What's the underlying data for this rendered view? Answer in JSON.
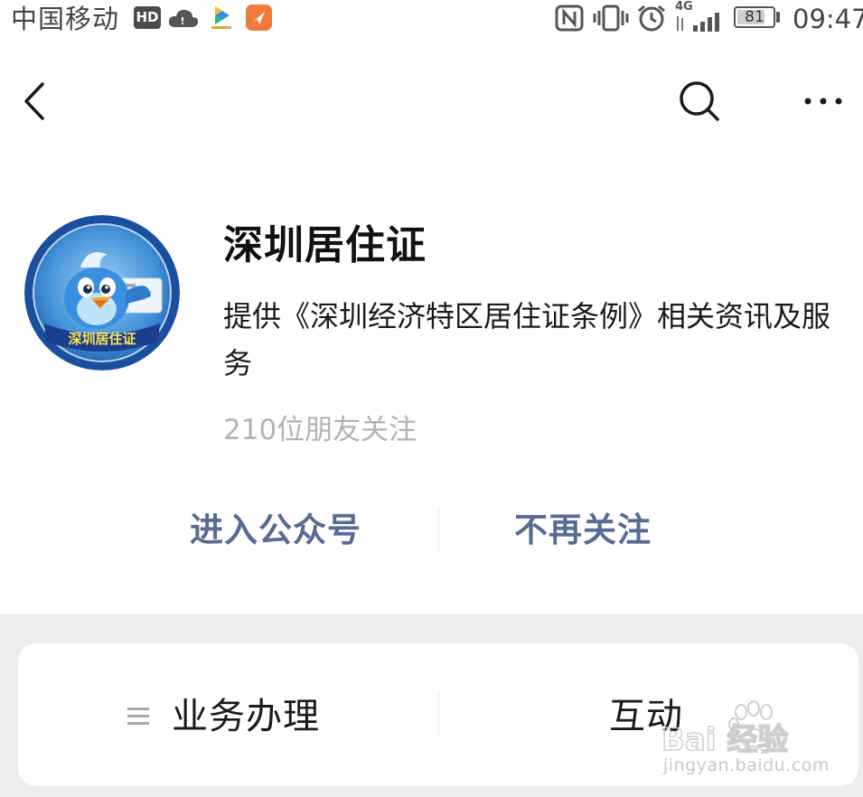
{
  "status_bar": {
    "carrier": "中国移动",
    "hd_label": "HD",
    "network_label": "4G",
    "battery": "81",
    "battery_level": 0.81,
    "time": "09:47"
  },
  "nav": {
    "back_icon": "chevron-left-icon",
    "search_icon": "search-icon",
    "more_icon": "more-dots-icon"
  },
  "profile": {
    "name": "深圳居住证",
    "description": "提供《深圳经济特区居住证条例》相关资讯及服务",
    "followers": "210位朋友关注",
    "avatar_banner": "深圳居住证"
  },
  "actions": {
    "enter_label": "进入公众号",
    "unfollow_label": "不再关注"
  },
  "menu": {
    "items": [
      {
        "label": "业务办理",
        "icon": "menu-list-icon"
      },
      {
        "label": "互动"
      }
    ]
  },
  "watermark": {
    "brand": "Bai 经验",
    "url": "jingyan.baidu.com"
  },
  "colors": {
    "link": "#576b95",
    "followers_text": "#b3b3b3",
    "background_band": "#ededed"
  }
}
